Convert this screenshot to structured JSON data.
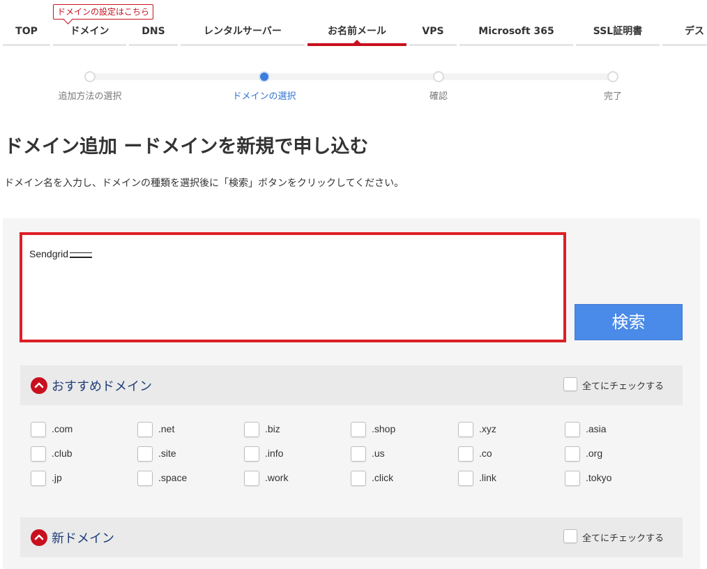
{
  "nav": {
    "tooltip": "ドメインの設定はこちら",
    "tabs": [
      {
        "label": "TOP"
      },
      {
        "label": "ドメイン"
      },
      {
        "label": "DNS"
      },
      {
        "label": "レンタルサーバー"
      },
      {
        "label": "お名前メール",
        "active": true
      },
      {
        "label": "VPS"
      },
      {
        "label": "Microsoft 365"
      },
      {
        "label": "SSL証明書"
      },
      {
        "label": "デス"
      }
    ]
  },
  "stepper": {
    "steps": [
      {
        "label": "追加方法の選択"
      },
      {
        "label": "ドメインの選択",
        "active": true
      },
      {
        "label": "確認"
      },
      {
        "label": "完了"
      }
    ]
  },
  "page": {
    "title": "ドメイン追加 ードメインを新規で申し込む",
    "description": "ドメイン名を入力し、ドメインの種類を選択後に「検索」ボタンをクリックしてください。"
  },
  "search": {
    "value": "Sendgrid",
    "button_label": "検索"
  },
  "recommended": {
    "title": "おすすめドメイン",
    "check_all": "全てにチェックする",
    "tlds": [
      ".com",
      ".net",
      ".biz",
      ".shop",
      ".xyz",
      ".asia",
      ".club",
      ".site",
      ".info",
      ".us",
      ".co",
      ".org",
      ".jp",
      ".space",
      ".work",
      ".click",
      ".link",
      ".tokyo"
    ]
  },
  "new_domains": {
    "title": "新ドメイン",
    "check_all": "全てにチェックする"
  },
  "colors": {
    "brand_red": "#c8101e",
    "search_border": "#dd1f26",
    "button_blue": "#4a8ae8",
    "step_active": "#3b7ddd"
  }
}
